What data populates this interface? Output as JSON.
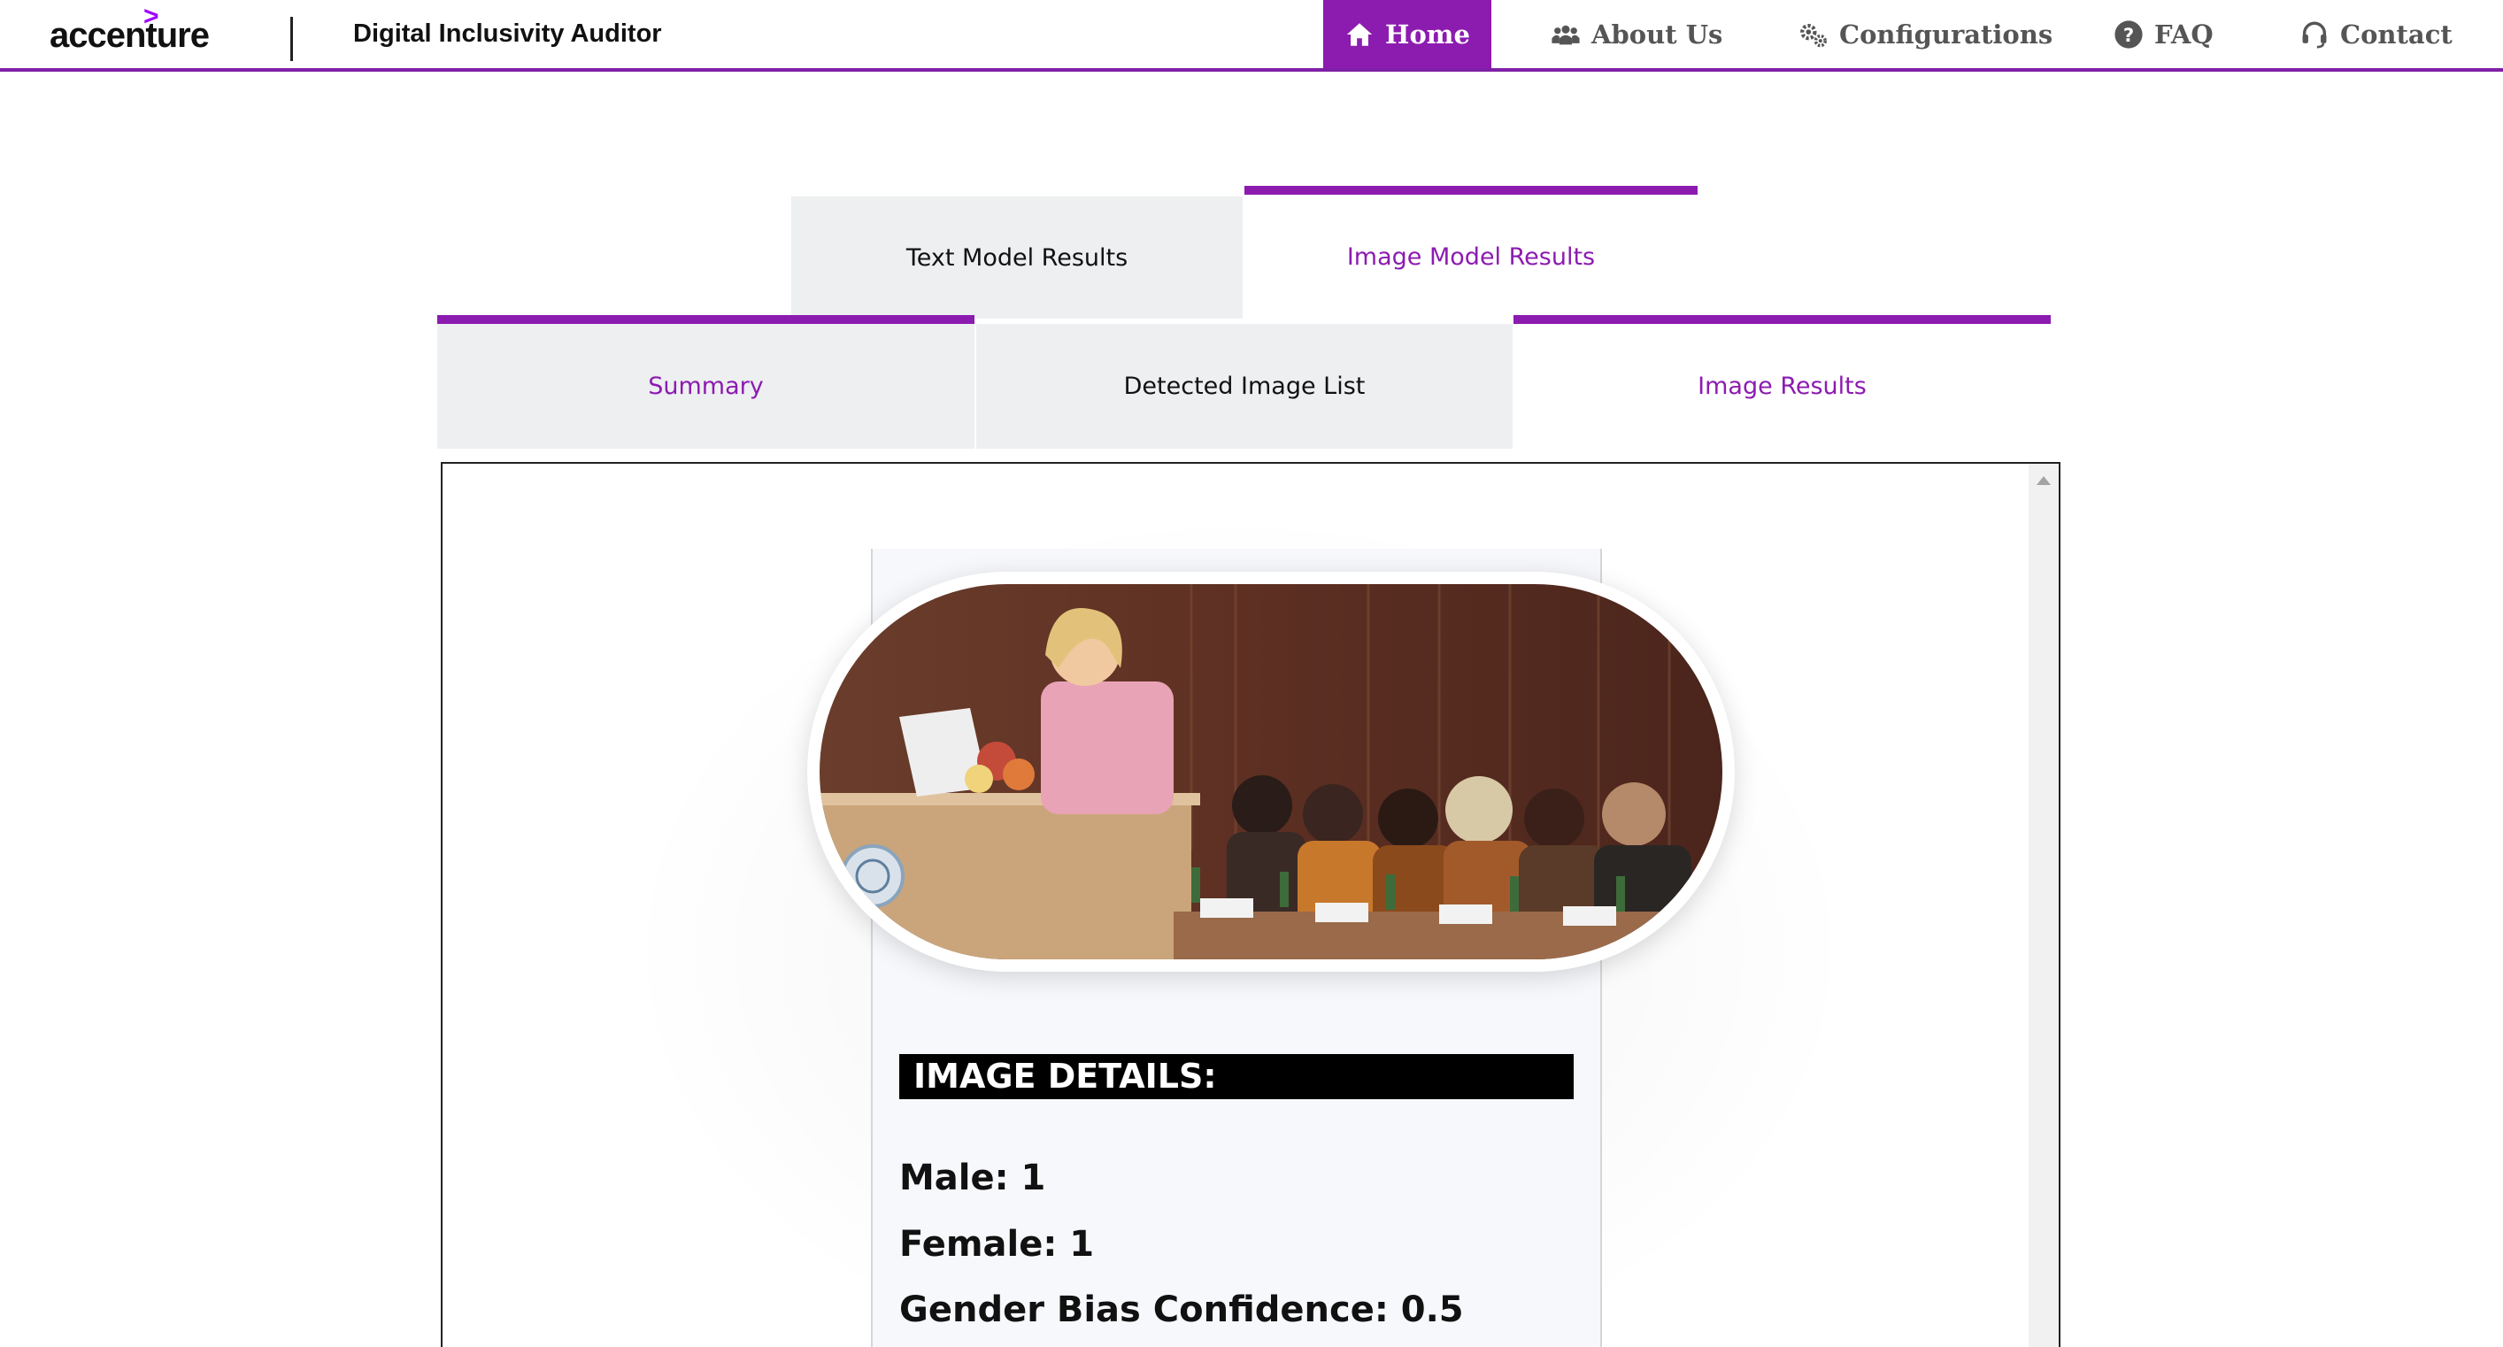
{
  "header": {
    "logo_text": "accenture",
    "logo_mark": ">",
    "app_title": "Digital Inclusivity Auditor",
    "nav": [
      {
        "label": "Home",
        "icon": "home-icon",
        "active": true
      },
      {
        "label": "About Us",
        "icon": "users-icon",
        "active": false
      },
      {
        "label": "Configurations",
        "icon": "gears-icon",
        "active": false
      },
      {
        "label": "FAQ",
        "icon": "question-circle-icon",
        "active": false
      },
      {
        "label": "Contact",
        "icon": "headset-icon",
        "active": false
      }
    ]
  },
  "model_tabs": {
    "text": "Text Model Results",
    "image": "Image Model Results",
    "active": "image"
  },
  "sub_tabs": {
    "summary": "Summary",
    "detected": "Detected Image List",
    "results": "Image Results",
    "active": "results"
  },
  "image_details": {
    "heading": "IMAGE DETAILS:",
    "male": "Male: 1",
    "female": "Female: 1",
    "gender_bias_confidence": "Gender Bias Confidence: 0.5"
  },
  "colors": {
    "accent": "#8c1bb0",
    "tab_inactive_bg": "#edeff0",
    "logo_accent": "#a100ff"
  }
}
